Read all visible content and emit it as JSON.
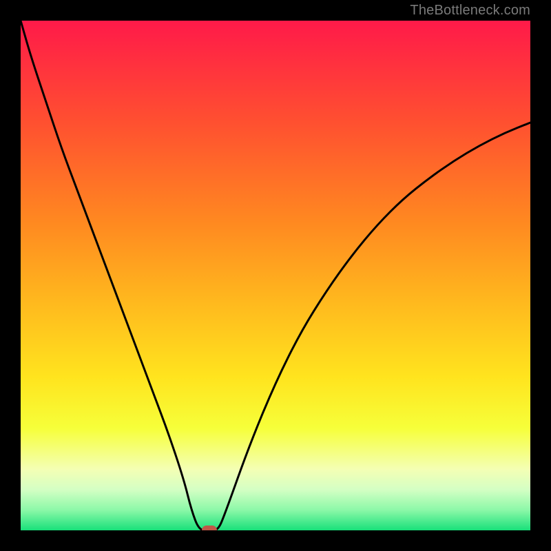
{
  "watermark": {
    "text": "TheBottleneck.com"
  },
  "chart_data": {
    "type": "line",
    "title": "",
    "xlabel": "",
    "ylabel": "",
    "xlim": [
      0,
      100
    ],
    "ylim": [
      0,
      100
    ],
    "x": [
      0,
      2,
      5,
      8,
      11,
      14,
      17,
      20,
      23,
      26,
      29,
      32,
      33.5,
      35,
      37,
      38.7,
      40,
      45,
      50,
      55,
      60,
      65,
      70,
      75,
      80,
      85,
      90,
      95,
      100
    ],
    "values": [
      100,
      93,
      84,
      75,
      67,
      59,
      51,
      43,
      35,
      27,
      19,
      10,
      4,
      0,
      0,
      0,
      3,
      17,
      29,
      39,
      47,
      54,
      60,
      65,
      69,
      72.5,
      75.5,
      78,
      80
    ],
    "flat_bottom_x_range": [
      35,
      38.7
    ],
    "marker": {
      "x": 37,
      "y": 0
    },
    "gradient_stops": [
      {
        "offset": 0.0,
        "color": "#ff1a49"
      },
      {
        "offset": 0.2,
        "color": "#ff5030"
      },
      {
        "offset": 0.4,
        "color": "#ff8a20"
      },
      {
        "offset": 0.55,
        "color": "#ffb81e"
      },
      {
        "offset": 0.7,
        "color": "#ffe41e"
      },
      {
        "offset": 0.8,
        "color": "#f6ff3a"
      },
      {
        "offset": 0.88,
        "color": "#f4ffb4"
      },
      {
        "offset": 0.92,
        "color": "#d4ffc4"
      },
      {
        "offset": 0.96,
        "color": "#8cf8a8"
      },
      {
        "offset": 1.0,
        "color": "#18e07a"
      }
    ]
  }
}
